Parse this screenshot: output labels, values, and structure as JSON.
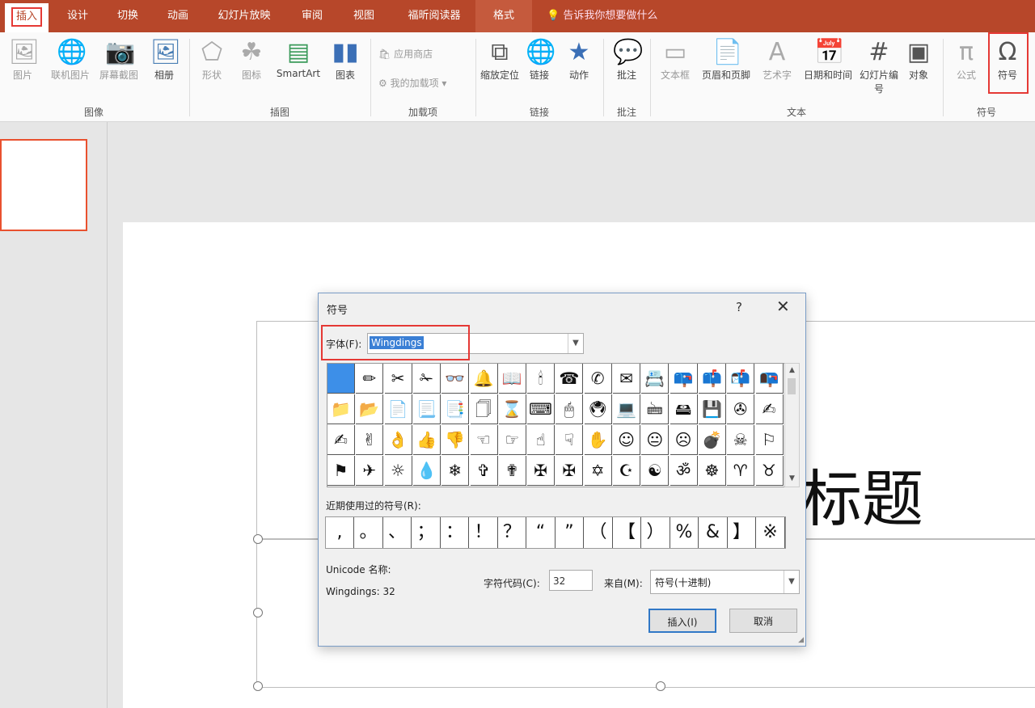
{
  "tabs": [
    {
      "label": "插入",
      "active": true
    },
    {
      "label": "设计"
    },
    {
      "label": "切换"
    },
    {
      "label": "动画"
    },
    {
      "label": "幻灯片放映"
    },
    {
      "label": "审阅"
    },
    {
      "label": "视图"
    },
    {
      "label": "福昕阅读器"
    },
    {
      "label": "格式"
    }
  ],
  "tellme": "告诉我你想要做什么",
  "ribbon": {
    "images": {
      "label": "图像",
      "items": [
        "图片",
        "联机图片",
        "屏幕截图",
        "相册"
      ]
    },
    "illustrations": {
      "label": "插图",
      "items": [
        "形状",
        "图标",
        "SmartArt",
        "图表"
      ]
    },
    "addins": {
      "label": "加载项",
      "items": [
        "应用商店",
        "我的加载项"
      ]
    },
    "links": {
      "label": "链接",
      "items": [
        "缩放定位",
        "链接",
        "动作"
      ]
    },
    "comments": {
      "label": "批注",
      "items": [
        "批注"
      ]
    },
    "text": {
      "label": "文本",
      "items": [
        "文本框",
        "页眉和页脚",
        "艺术字",
        "日期和时间",
        "幻灯片编号",
        "对象"
      ]
    },
    "symbols": {
      "label": "符号",
      "items": [
        "公式",
        "符号"
      ]
    }
  },
  "slide": {
    "title_fragment": "标题"
  },
  "dialog": {
    "title": "符号",
    "help": "?",
    "close": "✕",
    "font_label": "字体(F):",
    "font_value": "Wingdings",
    "symbols": [
      "",
      "✏",
      "✂",
      "✁",
      "👓",
      "🔔",
      "📖",
      "🕯",
      "☎",
      "✆",
      "✉",
      "📇",
      "📪",
      "📫",
      "📬",
      "📭",
      "📁",
      "📂",
      "📄",
      "📃",
      "📑",
      "🗍",
      "⌛",
      "⌨",
      "🖱",
      "🖲",
      "💻",
      "🖮",
      "🖴",
      "💾",
      "✇",
      "✍",
      "✍",
      "✌",
      "👌",
      "👍",
      "👎",
      "☜",
      "☞",
      "☝",
      "☟",
      "✋",
      "☺",
      "😐",
      "☹",
      "💣",
      "☠",
      "⚐",
      "⚑",
      "✈",
      "☼",
      "💧",
      "❄",
      "✞",
      "✟",
      "✠",
      "✠",
      "✡",
      "☪",
      "☯",
      "ॐ",
      "☸",
      "♈",
      "♉"
    ],
    "recent_label": "近期使用过的符号(R):",
    "recent": [
      ",",
      "。",
      "、",
      "；",
      "：",
      "！",
      "？",
      "“",
      "”",
      "（",
      "【",
      "）",
      "%",
      "&",
      "】",
      "※"
    ],
    "unicode_label": "Unicode 名称:",
    "unicode_name": "Wingdings: 32",
    "code_label": "字符代码(C):",
    "code_value": "32",
    "from_label": "来自(M):",
    "from_value": "符号(十进制)",
    "insert_button": "插入(I)",
    "cancel_button": "取消"
  }
}
